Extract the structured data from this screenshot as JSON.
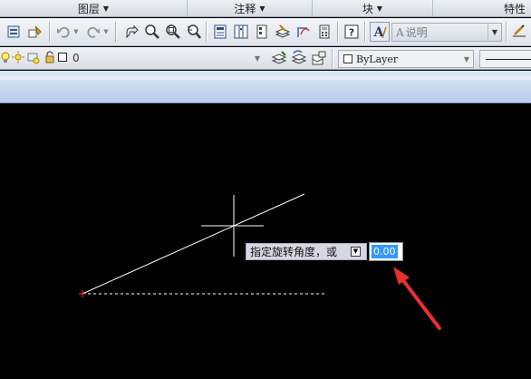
{
  "ribbon_panels": [
    {
      "label": "图层"
    },
    {
      "label": "注释"
    },
    {
      "label": "块"
    },
    {
      "label": "特性"
    }
  ],
  "toolbar1": {
    "text_style": "说明",
    "icons": [
      "layer-manager-icon",
      "match-props-icon",
      "undo-icon",
      "redo-icon",
      "pan-realtime-icon",
      "zoom-realtime-icon",
      "zoom-window-icon",
      "zoom-previous-icon",
      "properties-icon",
      "design-center-icon",
      "tool-palettes-icon",
      "sheet-set-icon",
      "markup-icon",
      "quick-calc-icon",
      "help-icon",
      "text-style-icon",
      "dimension-style-icon"
    ]
  },
  "toolbar2": {
    "layer_name": "0",
    "color": "ByLayer"
  },
  "canvas": {
    "prompt_text": "指定旋转角度，或",
    "angle_value": "0.00"
  },
  "colors": {
    "canvas_bg": "#000000",
    "crosshair": "#ffffff",
    "rubber_band": "#ffffff",
    "base_point": "#ff3030",
    "annotation_arrow": "#e83030",
    "selection": "#3399ff"
  }
}
